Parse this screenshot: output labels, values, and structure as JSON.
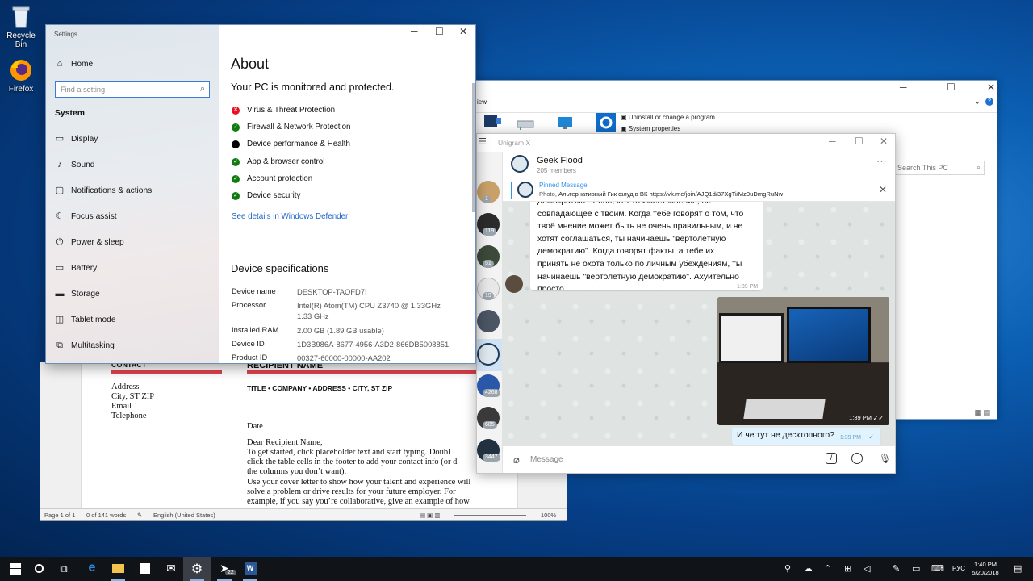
{
  "desktop": {
    "icons": [
      {
        "label": "Recycle Bin",
        "icon": "recycle-bin-icon"
      },
      {
        "label": "Firefox",
        "icon": "firefox-icon"
      }
    ]
  },
  "explorer": {
    "ribbon_tab": "iew",
    "uninstall": "Uninstall or change a program",
    "system_properties": "System properties",
    "search_placeholder": "Search This PC"
  },
  "word": {
    "contact_heading": "CONTACT",
    "contact_lines": [
      "Address",
      "City, ST ZIP",
      "Email",
      "Telephone"
    ],
    "recipient_heading": "RECIPIENT NAME",
    "title_line": "TITLE • COMPANY • ADDRESS • CITY, ST ZIP",
    "date": "Date",
    "greeting": "Dear Recipient Name,",
    "body_1": "To get started, click placeholder text and start typing. Doubl\nclick the table cells in the footer to add your contact info (or d\nthe columns you don’t want).",
    "body_2": "Use your cover letter to show how your talent and experience will\nsolve a problem or drive results for your future employer. For\nexample, if you say you’re collaborative, give an example of how",
    "status": {
      "page": "Page 1 of 1",
      "words": "0 of 141 words",
      "language": "English (United States)",
      "zoom": "100%"
    }
  },
  "unigram": {
    "title": "Unigram X",
    "chat_name": "Geek Flood",
    "members": "205 members",
    "pinned_title": "Pinned Message",
    "pinned_prefix": "Photo,",
    "pinned_text": "Альтернативный Гик флуд в ВК https://vk.me/join/AJQ1d/37XgTi/Mz0uDmgRuNw",
    "chats": [
      {
        "badge": "1",
        "color": "#c9a06a"
      },
      {
        "badge": "119",
        "color": "#2b2b2b"
      },
      {
        "badge": "51",
        "color": "#3c4a3a"
      },
      {
        "badge": "19",
        "color": "#e8e8e8"
      },
      {
        "badge": "",
        "color": "#4b5563"
      },
      {
        "badge": "",
        "color": "#dfe7ef"
      },
      {
        "badge": "4268",
        "color": "#2a58a8"
      },
      {
        "badge": "685",
        "color": "#3a3a3a"
      },
      {
        "badge": "3447",
        "color": "#22313f"
      }
    ],
    "message_text": "демократию\". Если, кто-то имеет мнение, не\nсовпадающее с твоим. Когда тебе говорят о том, что\nтвоё мнение может быть не очень правильным, и не\nхотят соглашаться, ты начинаешь \"вертолётную\nдемократию\". Когда говорят факты, а тебе их\nпринять не охота только по личным убеждениям, ты\nначинаешь \"вертолётную демократию\". Ахуительно\nпросто",
    "message_time": "1:39 PM",
    "photo_time": "1:39 PM",
    "own_message": "И че тут не десктопного?",
    "own_time": "1:39 PM",
    "composer_placeholder": "Message"
  },
  "settings": {
    "window_title": "Settings",
    "home": "Home",
    "search_placeholder": "Find a setting",
    "section": "System",
    "nav": [
      {
        "label": "Display",
        "icon": "display-icon"
      },
      {
        "label": "Sound",
        "icon": "sound-icon"
      },
      {
        "label": "Notifications & actions",
        "icon": "notifications-icon"
      },
      {
        "label": "Focus assist",
        "icon": "focus-assist-icon"
      },
      {
        "label": "Power & sleep",
        "icon": "power-icon"
      },
      {
        "label": "Battery",
        "icon": "battery-icon"
      },
      {
        "label": "Storage",
        "icon": "storage-icon"
      },
      {
        "label": "Tablet mode",
        "icon": "tablet-mode-icon"
      },
      {
        "label": "Multitasking",
        "icon": "multitasking-icon"
      }
    ],
    "page_title": "About",
    "protection_title": "Your PC is monitored and protected.",
    "protection": [
      {
        "label": "Virus & Threat Protection",
        "status": "error",
        "color": "#e81123"
      },
      {
        "label": "Firewall & Network Protection",
        "status": "ok",
        "color": "#107c10"
      },
      {
        "label": "Device performance & Health",
        "status": "neutral",
        "color": "#000000"
      },
      {
        "label": "App & browser control",
        "status": "ok",
        "color": "#107c10"
      },
      {
        "label": "Account protection",
        "status": "ok",
        "color": "#107c10"
      },
      {
        "label": "Device security",
        "status": "ok",
        "color": "#107c10"
      }
    ],
    "defender_link": "See details in Windows Defender",
    "specs_title": "Device specifications",
    "specs": [
      {
        "key": "Device name",
        "value": "DESKTOP-TAOFD7I"
      },
      {
        "key": "Processor",
        "value": "Intel(R) Atom(TM) CPU  Z3740  @ 1.33GHz\n1.33 GHz"
      },
      {
        "key": "Installed RAM",
        "value": "2.00 GB (1.89 GB usable)"
      },
      {
        "key": "Device ID",
        "value": "1D3B986A-8677-4956-A3D2-866DB5008851"
      },
      {
        "key": "Product ID",
        "value": "00327-60000-00000-AA202"
      }
    ]
  },
  "taskbar": {
    "unigram_badge": "22",
    "language": "РУС",
    "time": "1:40 PM",
    "date": "5/20/2018"
  }
}
